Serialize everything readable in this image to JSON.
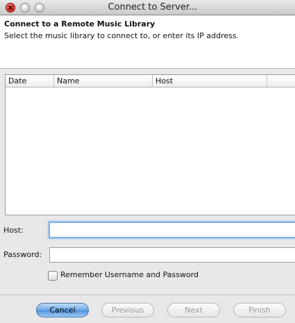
{
  "window": {
    "title": "Connect to Server..."
  },
  "header": {
    "title": "Connect to a Remote Music Library",
    "description": "Select the music library to connect to, or enter its IP address."
  },
  "table": {
    "columns": [
      "Date",
      "Name",
      "Host",
      ""
    ],
    "rows": []
  },
  "form": {
    "host_label": "Host:",
    "host_value": "",
    "password_label": "Password:",
    "password_value": "",
    "remember_label": "Remember Username and Password",
    "remember_checked": false
  },
  "buttons": {
    "cancel": "Cancel",
    "previous": "Previous",
    "next": "Next",
    "finish": "Finish"
  },
  "colors": {
    "accent": "#5b9be3",
    "focus_ring": "#9fc3ec",
    "close": "#e0352b"
  }
}
